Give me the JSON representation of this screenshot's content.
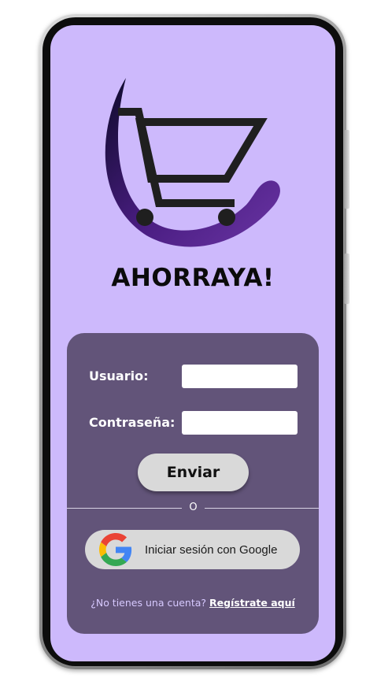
{
  "brand": {
    "title": "AHORRAYA!",
    "logo_icon": "shopping-cart-icon"
  },
  "colors": {
    "screen_bg": "#cdb9fc",
    "card_bg": "#625479",
    "accent_purple": "#5a2590",
    "button_bg": "#d9d9d9"
  },
  "login_form": {
    "username_label": "Usuario:",
    "username_value": "",
    "password_label": "Contraseña:",
    "password_value": "",
    "submit_label": "Enviar",
    "divider_text": "O",
    "google_button_label": "Iniciar sesión con Google",
    "google_icon": "google-icon",
    "signup_question": "¿No tienes una cuenta?",
    "signup_link": "Regístrate aquí"
  }
}
